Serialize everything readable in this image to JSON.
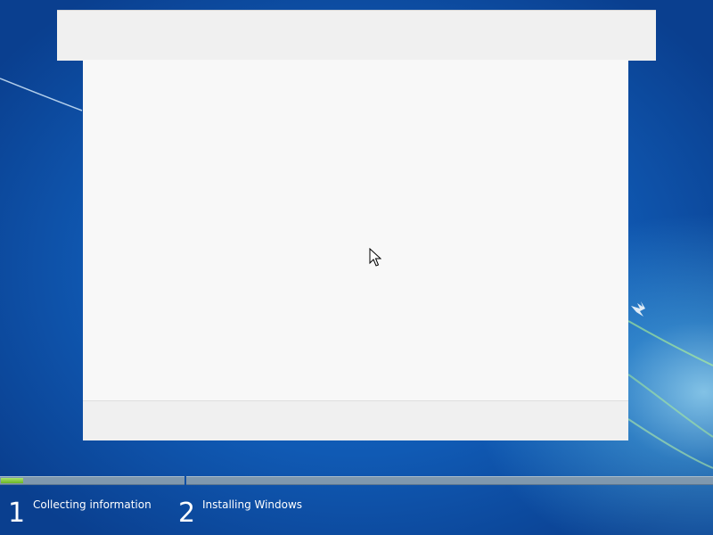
{
  "setup_window": {
    "title": "",
    "content": ""
  },
  "install_progress": {
    "steps": [
      {
        "number": "1",
        "label": "Collecting information",
        "progress_fraction": 0.12
      },
      {
        "number": "2",
        "label": "Installing Windows",
        "progress_fraction": 0
      }
    ]
  },
  "colors": {
    "desktop_blue": "#105ab4",
    "window_gray": "#f0f0f0",
    "content_white": "#f8f8f8",
    "progress_green": "#7ccb35",
    "progress_track": "#7f98ae"
  }
}
